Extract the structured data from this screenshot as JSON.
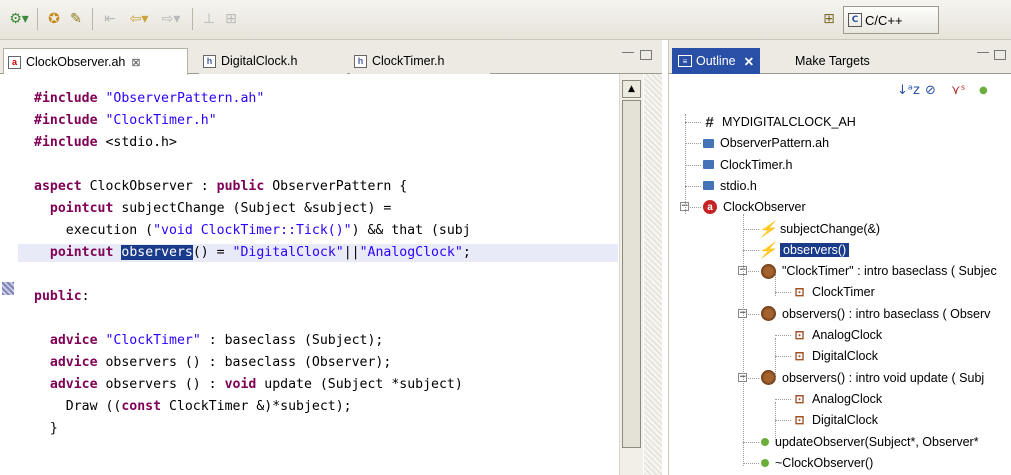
{
  "toolbar": {
    "perspective_label": "C/C++"
  },
  "editor": {
    "tabs": [
      {
        "label": "ClockObserver.ah",
        "type": "a"
      },
      {
        "label": "DigitalClock.h",
        "type": "h"
      },
      {
        "label": "ClockTimer.h",
        "type": "h"
      }
    ]
  },
  "code": {
    "lines": [
      {
        "parts": [
          {
            "t": "#include",
            "c": "kw"
          },
          {
            "t": " "
          },
          {
            "t": "\"ObserverPattern.ah\"",
            "c": "str"
          }
        ]
      },
      {
        "parts": [
          {
            "t": "#include",
            "c": "kw"
          },
          {
            "t": " "
          },
          {
            "t": "\"ClockTimer.h\"",
            "c": "str"
          }
        ]
      },
      {
        "parts": [
          {
            "t": "#include",
            "c": "kw"
          },
          {
            "t": " <stdio.h>"
          }
        ]
      },
      {
        "parts": []
      },
      {
        "parts": [
          {
            "t": "aspect",
            "c": "kw"
          },
          {
            "t": " ClockObserver : "
          },
          {
            "t": "public",
            "c": "kw"
          },
          {
            "t": " ObserverPattern {"
          }
        ]
      },
      {
        "parts": [
          {
            "t": "  "
          },
          {
            "t": "pointcut",
            "c": "kw"
          },
          {
            "t": " subjectChange (Subject &subject) ="
          }
        ]
      },
      {
        "parts": [
          {
            "t": "    execution ("
          },
          {
            "t": "\"void ClockTimer::Tick()\"",
            "c": "str"
          },
          {
            "t": ") && that (subj"
          }
        ]
      },
      {
        "parts": [
          {
            "t": "  "
          },
          {
            "t": "pointcut",
            "c": "kw"
          },
          {
            "t": " "
          },
          {
            "t": "observers",
            "c": "sel"
          },
          {
            "t": "() = "
          },
          {
            "t": "\"DigitalClock\"",
            "c": "str"
          },
          {
            "t": "||"
          },
          {
            "t": "\"AnalogClock\"",
            "c": "str"
          },
          {
            "t": ";"
          }
        ],
        "highlight": true
      },
      {
        "parts": []
      },
      {
        "parts": [
          {
            "t": "public",
            "c": "kw"
          },
          {
            "t": ":"
          }
        ]
      },
      {
        "parts": []
      },
      {
        "parts": [
          {
            "t": "  "
          },
          {
            "t": "advice",
            "c": "kw"
          },
          {
            "t": " "
          },
          {
            "t": "\"ClockTimer\"",
            "c": "str"
          },
          {
            "t": " : baseclass (Subject);"
          }
        ]
      },
      {
        "parts": [
          {
            "t": "  "
          },
          {
            "t": "advice",
            "c": "kw"
          },
          {
            "t": " observers () : baseclass (Observer);"
          }
        ]
      },
      {
        "parts": [
          {
            "t": "  "
          },
          {
            "t": "advice",
            "c": "kw"
          },
          {
            "t": " observers () : "
          },
          {
            "t": "void",
            "c": "kw"
          },
          {
            "t": " update (Subject *subject)"
          }
        ]
      },
      {
        "parts": [
          {
            "t": "    Draw (("
          },
          {
            "t": "const",
            "c": "kw"
          },
          {
            "t": " ClockTimer &)*subject);"
          }
        ]
      },
      {
        "parts": [
          {
            "t": "  }"
          }
        ]
      }
    ]
  },
  "outline": {
    "tabs": [
      {
        "label": "Outline",
        "close": "✕"
      },
      {
        "label": "Make Targets"
      }
    ],
    "tools": [
      "↓ᵃz",
      "⊘",
      "⋎ˢ",
      "●"
    ],
    "tree": [
      {
        "depth": 1,
        "icon": "hash",
        "icon_name": "macro-icon",
        "label": "MYDIGITALCLOCK_AH"
      },
      {
        "depth": 1,
        "icon": "inc",
        "icon_name": "include-icon",
        "label": "ObserverPattern.ah"
      },
      {
        "depth": 1,
        "icon": "inc",
        "icon_name": "include-icon",
        "label": "ClockTimer.h"
      },
      {
        "depth": 1,
        "icon": "inc",
        "icon_name": "include-icon",
        "label": "stdio.h"
      },
      {
        "depth": 1,
        "icon": "aspect",
        "icon_name": "aspect-icon",
        "label": "ClockObserver",
        "twisty": "−"
      },
      {
        "depth": 2,
        "icon": "pc",
        "icon_name": "pointcut-icon",
        "label": "subjectChange(&)"
      },
      {
        "depth": 2,
        "icon": "pc",
        "icon_name": "pointcut-icon",
        "label": "observers()",
        "selected": true
      },
      {
        "depth": 2,
        "icon": "intro",
        "icon_name": "introduction-icon",
        "label": "\"ClockTimer\" : intro baseclass ( Subjec",
        "twisty": "−"
      },
      {
        "depth": 3,
        "icon": "class",
        "icon_name": "class-icon",
        "label": "ClockTimer"
      },
      {
        "depth": 2,
        "icon": "intro",
        "icon_name": "introduction-icon",
        "label": "observers() : intro baseclass ( Observ",
        "twisty": "−"
      },
      {
        "depth": 3,
        "icon": "class",
        "icon_name": "class-icon",
        "label": "AnalogClock"
      },
      {
        "depth": 3,
        "icon": "class",
        "icon_name": "class-icon",
        "label": "DigitalClock"
      },
      {
        "depth": 2,
        "icon": "intro",
        "icon_name": "introduction-icon",
        "label": "observers() : intro void update ( Subj",
        "twisty": "−"
      },
      {
        "depth": 3,
        "icon": "class",
        "icon_name": "class-icon",
        "label": "AnalogClock"
      },
      {
        "depth": 3,
        "icon": "class",
        "icon_name": "class-icon",
        "label": "DigitalClock"
      },
      {
        "depth": 2,
        "icon": "method",
        "icon_name": "method-icon",
        "label": "updateObserver(Subject*, Observer*"
      },
      {
        "depth": 2,
        "icon": "method",
        "icon_name": "method-icon",
        "label": "~ClockObserver()"
      }
    ]
  }
}
